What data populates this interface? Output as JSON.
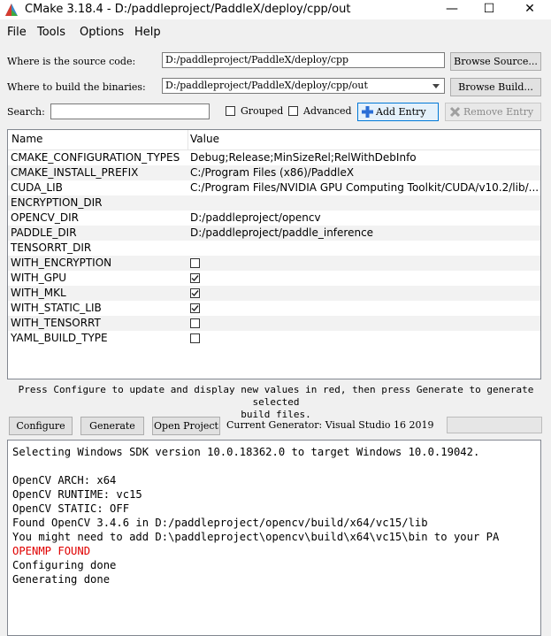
{
  "window": {
    "title": "CMake 3.18.4 - D:/paddleproject/PaddleX/deploy/cpp/out",
    "minimize": "—",
    "maximize": "☐",
    "close": "✕"
  },
  "menu": {
    "file": "File",
    "tools": "Tools",
    "options": "Options",
    "help": "Help"
  },
  "source": {
    "label": "Where is the source code:",
    "value": "D:/paddleproject/PaddleX/deploy/cpp",
    "browse": "Browse Source..."
  },
  "build": {
    "label": "Where to build the binaries:",
    "value": "D:/paddleproject/PaddleX/deploy/cpp/out",
    "browse": "Browse Build..."
  },
  "search": {
    "label": "Search:",
    "value": "",
    "grouped": "Grouped",
    "advanced": "Advanced",
    "add_entry": "Add Entry",
    "remove_entry": "Remove Entry"
  },
  "table": {
    "col_name": "Name",
    "col_value": "Value",
    "rows": [
      {
        "name": "CMAKE_CONFIGURATION_TYPES",
        "value": "Debug;Release;MinSizeRel;RelWithDebInfo"
      },
      {
        "name": "CMAKE_INSTALL_PREFIX",
        "value": "C:/Program Files (x86)/PaddleX"
      },
      {
        "name": "CUDA_LIB",
        "value": "C:/Program Files/NVIDIA GPU Computing Toolkit/CUDA/v10.2/lib/..."
      },
      {
        "name": "ENCRYPTION_DIR",
        "value": ""
      },
      {
        "name": "OPENCV_DIR",
        "value": "D:/paddleproject/opencv"
      },
      {
        "name": "PADDLE_DIR",
        "value": "D:/paddleproject/paddle_inference"
      },
      {
        "name": "TENSORRT_DIR",
        "value": ""
      },
      {
        "name": "WITH_ENCRYPTION",
        "checked": false
      },
      {
        "name": "WITH_GPU",
        "checked": true
      },
      {
        "name": "WITH_MKL",
        "checked": true
      },
      {
        "name": "WITH_STATIC_LIB",
        "checked": true
      },
      {
        "name": "WITH_TENSORRT",
        "checked": false
      },
      {
        "name": "YAML_BUILD_TYPE",
        "checked": false
      }
    ]
  },
  "hint": {
    "line1": "Press Configure to update and display new values in red, then press Generate to generate selected",
    "line2": "build files."
  },
  "actions": {
    "configure": "Configure",
    "generate": "Generate",
    "open_project": "Open Project",
    "generator_label": "Current Generator: Visual Studio 16 2019"
  },
  "output": {
    "red_color": "#e00000",
    "lines": [
      {
        "text": "Selecting Windows SDK version 10.0.18362.0 to target Windows 10.0.19042.",
        "red": false
      },
      {
        "text": "",
        "red": false
      },
      {
        "text": "OpenCV ARCH: x64",
        "red": false
      },
      {
        "text": "OpenCV RUNTIME: vc15",
        "red": false
      },
      {
        "text": "OpenCV STATIC: OFF",
        "red": false
      },
      {
        "text": "Found OpenCV 3.4.6 in D:/paddleproject/opencv/build/x64/vc15/lib",
        "red": false
      },
      {
        "text": "You might need to add D:\\paddleproject\\opencv\\build\\x64\\vc15\\bin to your PA",
        "red": false
      },
      {
        "text": "OPENMP FOUND",
        "red": true
      },
      {
        "text": "Configuring done",
        "red": false
      },
      {
        "text": "Generating done",
        "red": false
      }
    ]
  }
}
